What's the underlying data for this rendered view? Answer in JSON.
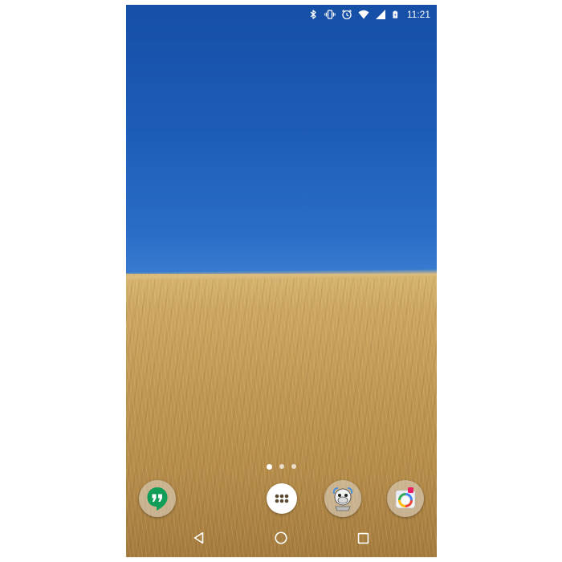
{
  "status_bar": {
    "icons": [
      "bluetooth-icon",
      "vibrate-icon",
      "alarm-icon",
      "wifi-icon",
      "cell-signal-icon",
      "battery-charging-icon"
    ],
    "time": "11:21",
    "color": "#ffffff"
  },
  "wallpaper": {
    "description_colors": {
      "sky": "#1c5cb8",
      "field": "#c29a55"
    }
  },
  "home": {
    "page_count": 3,
    "current_page": 1
  },
  "dock": {
    "apps": [
      {
        "icon": "hangouts-icon",
        "color": "#0f9d58"
      },
      {
        "icon": "app-drawer-icon",
        "color": "#ffffff"
      },
      {
        "icon": "mascot-app-icon",
        "color": "#e0e0e0"
      },
      {
        "icon": "camera-icon",
        "color": "#e0e0e0"
      }
    ]
  },
  "nav_bar": {
    "icons": [
      "back-icon",
      "home-icon",
      "recents-icon"
    ]
  }
}
